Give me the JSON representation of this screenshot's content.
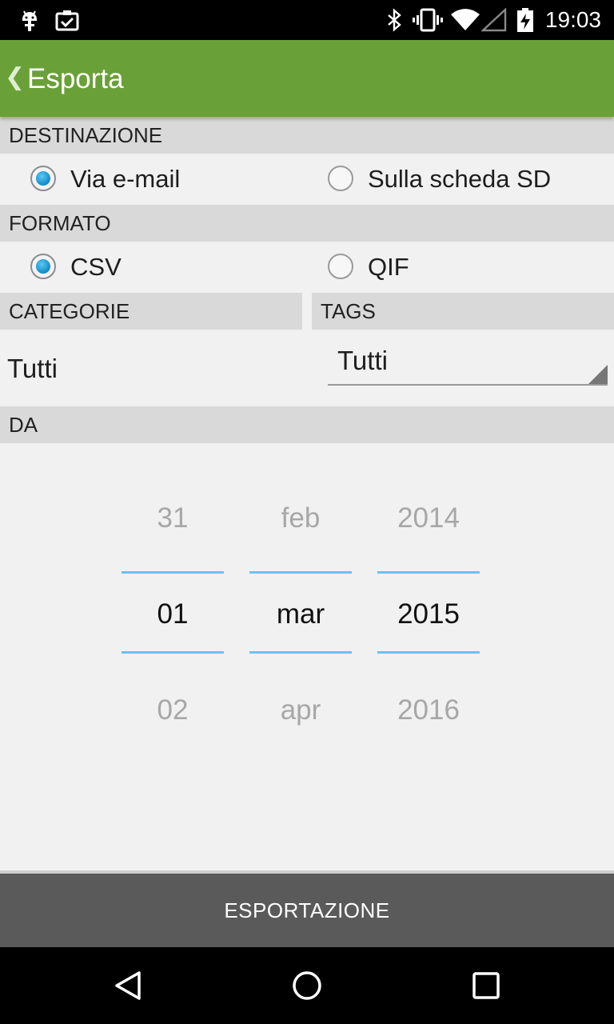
{
  "status_bar": {
    "time": "19:03",
    "icons": [
      "android-debug-icon",
      "clipboard-check-icon",
      "bluetooth-icon",
      "vibrate-icon",
      "wifi-icon",
      "signal-icon",
      "battery-charging-icon"
    ]
  },
  "action_bar": {
    "back_glyph": "❮",
    "title": "Esporta"
  },
  "destination": {
    "header": "DESTINAZIONE",
    "options": [
      {
        "label": "Via e-mail",
        "checked": true
      },
      {
        "label": "Sulla scheda SD",
        "checked": false
      }
    ]
  },
  "format": {
    "header": "FORMATO",
    "options": [
      {
        "label": "CSV",
        "checked": true
      },
      {
        "label": "QIF",
        "checked": false
      }
    ]
  },
  "categories": {
    "header": "CATEGORIE",
    "value": "Tutti"
  },
  "tags": {
    "header": "TAGS",
    "value": "Tutti"
  },
  "from": {
    "header": "DA",
    "picker": {
      "day": {
        "prev": "31",
        "selected": "01",
        "next": "02"
      },
      "month": {
        "prev": "feb",
        "selected": "mar",
        "next": "apr"
      },
      "year": {
        "prev": "2014",
        "selected": "2015",
        "next": "2016"
      }
    }
  },
  "export_button": "ESPORTAZIONE",
  "colors": {
    "action_bar": "#6aa038",
    "accent": "#6cc3ea",
    "button": "#5a5a5a"
  },
  "nav_bar": {
    "icons": [
      "back-nav-icon",
      "home-nav-icon",
      "recents-nav-icon"
    ]
  }
}
